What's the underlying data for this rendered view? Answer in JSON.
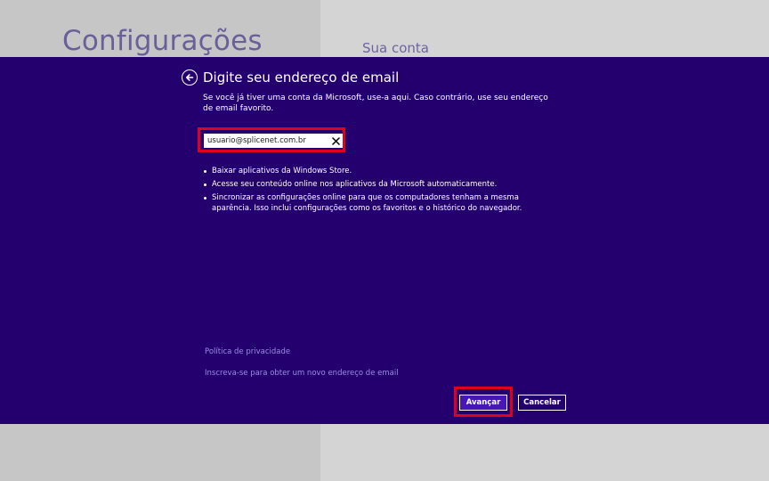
{
  "background": {
    "title": "Configurações",
    "subtitle": "Sua conta"
  },
  "dialog": {
    "title": "Digite seu endereço de email",
    "description": "Se você já tiver uma conta da Microsoft, use-a aqui. Caso contrário, use seu endereço de email favorito.",
    "email_field": {
      "value": "usuario@splicenet.com.br",
      "clear_icon": "close-icon"
    },
    "back_icon": "arrow-left-circle-icon",
    "bullets": [
      "Baixar aplicativos da Windows Store.",
      "Acesse seu conteúdo online nos aplicativos da Microsoft automaticamente.",
      "Sincronizar as configurações online para que os computadores tenham a mesma aparência. Isso inclui configurações como os favoritos e o histórico do navegador."
    ],
    "links": {
      "privacy": "Política de privacidade",
      "signup": "Inscreva-se para obter um novo endereço de email"
    },
    "buttons": {
      "next": "Avançar",
      "cancel": "Cancelar"
    }
  },
  "colors": {
    "dialog_bg": "#24006e",
    "accent_button": "#4617b4",
    "link": "#9d8ae6",
    "highlight": "#e0001a"
  }
}
